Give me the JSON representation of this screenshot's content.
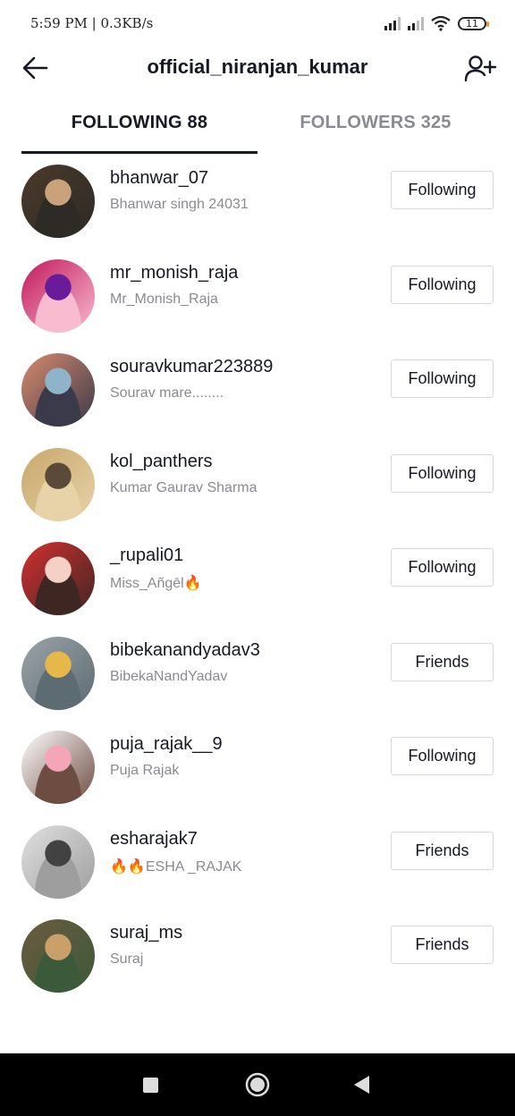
{
  "status_bar": {
    "time_speed": "5:59 PM | 0.3KB/s",
    "battery_level": "11"
  },
  "header": {
    "title": "official_niranjan_kumar",
    "back_icon": "arrow-left-icon",
    "add_user_icon": "add-user-icon"
  },
  "tabs": {
    "following": "FOLLOWING 88",
    "followers": "FOLLOWERS 325",
    "active": "following"
  },
  "users": [
    {
      "username": "bhanwar_07",
      "nickname": "Bhanwar singh 24031",
      "button": "Following",
      "colors": [
        "#4b3a2a",
        "#c9a27c",
        "#2e2a26"
      ]
    },
    {
      "username": "mr_monish_raja",
      "nickname": "Mr_Monish_Raja",
      "button": "Following",
      "colors": [
        "#c2185b",
        "#6a1b9a",
        "#f8bbd0"
      ]
    },
    {
      "username": "souravkumar223889",
      "nickname": "Sourav mare........",
      "button": "Following",
      "colors": [
        "#d98a6c",
        "#8fb3c9",
        "#3a3a4a"
      ]
    },
    {
      "username": "kol_panthers",
      "nickname": "Kumar Gaurav Sharma",
      "button": "Following",
      "colors": [
        "#c8a86a",
        "#5b4a3a",
        "#e8d2a8"
      ]
    },
    {
      "username": "_rupali01",
      "nickname": "Miss_Añgēl🔥",
      "button": "Following",
      "colors": [
        "#d32f2f",
        "#f5d0c5",
        "#3e2723"
      ]
    },
    {
      "username": "bibekanandyadav3",
      "nickname": "BibekaNandYadav",
      "button": "Friends",
      "colors": [
        "#9aa3a8",
        "#e6b84a",
        "#5d6b73"
      ]
    },
    {
      "username": "puja_rajak__9",
      "nickname": "Puja Rajak",
      "button": "Following",
      "colors": [
        "#ffffff",
        "#f4a6b8",
        "#6d4c41"
      ]
    },
    {
      "username": "esharajak7",
      "nickname": "🔥🔥ESHA _RAJAK",
      "button": "Friends",
      "colors": [
        "#e0e0e0",
        "#424242",
        "#9e9e9e"
      ]
    },
    {
      "username": "suraj_ms",
      "nickname": "Suraj",
      "button": "Friends",
      "colors": [
        "#6d5a3f",
        "#c9a06a",
        "#3b5a3a"
      ]
    }
  ],
  "nav_bar": {
    "recents_icon": "square-icon",
    "home_icon": "circle-icon",
    "back_icon": "triangle-back-icon"
  }
}
